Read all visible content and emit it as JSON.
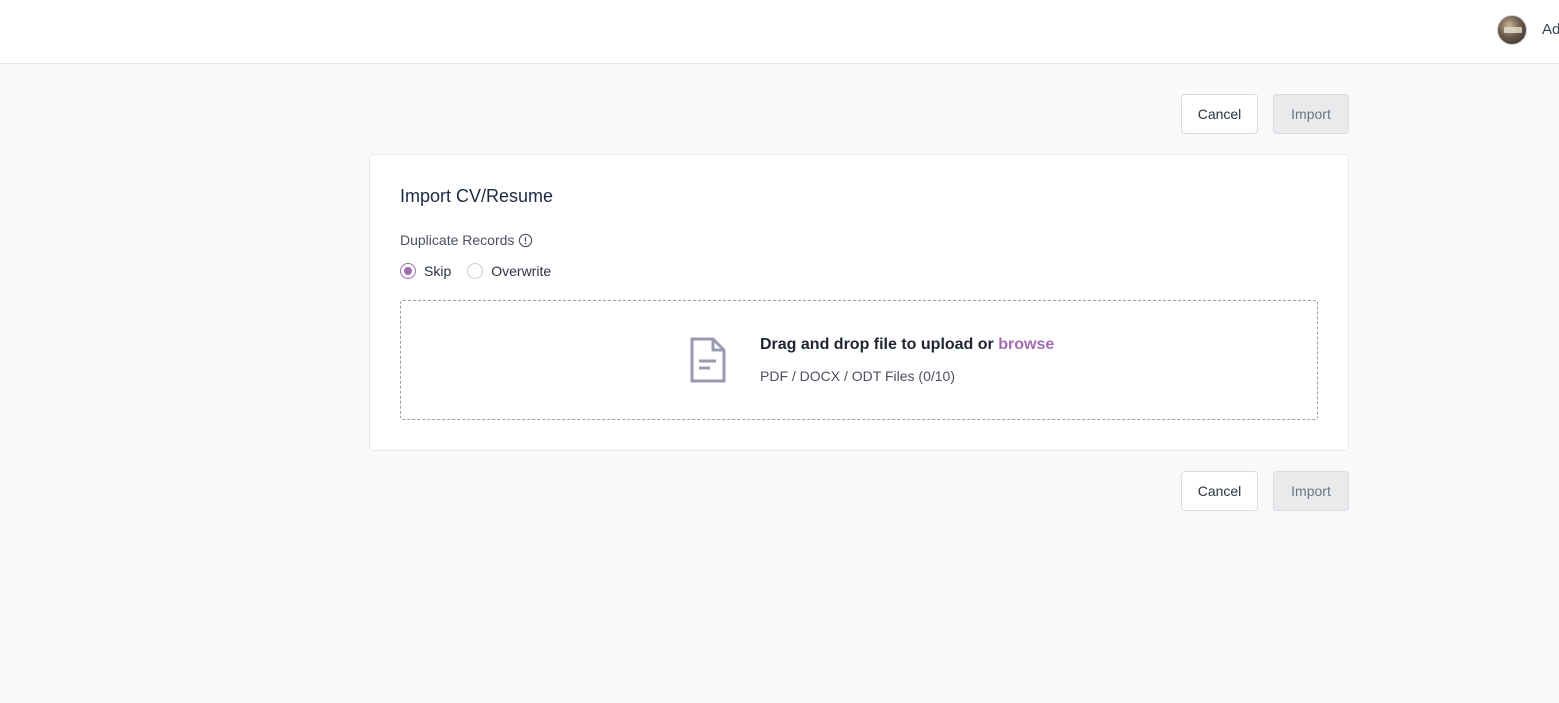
{
  "header": {
    "user_name": "Ad"
  },
  "actions": {
    "cancel_label": "Cancel",
    "import_label": "Import"
  },
  "card": {
    "title": "Import CV/Resume",
    "duplicate_label": "Duplicate Records",
    "duplicate_options": [
      {
        "label": "Skip",
        "selected": true
      },
      {
        "label": "Overwrite",
        "selected": false
      }
    ]
  },
  "dropzone": {
    "main_text": "Drag and drop file to upload or",
    "browse_text": "browse",
    "sub_text": "PDF / DOCX / ODT Files (0/10)"
  },
  "colors": {
    "accent": "#a46cb5",
    "page_bg": "#f8f9fb",
    "disabled_button_bg": "#e9eaec"
  }
}
